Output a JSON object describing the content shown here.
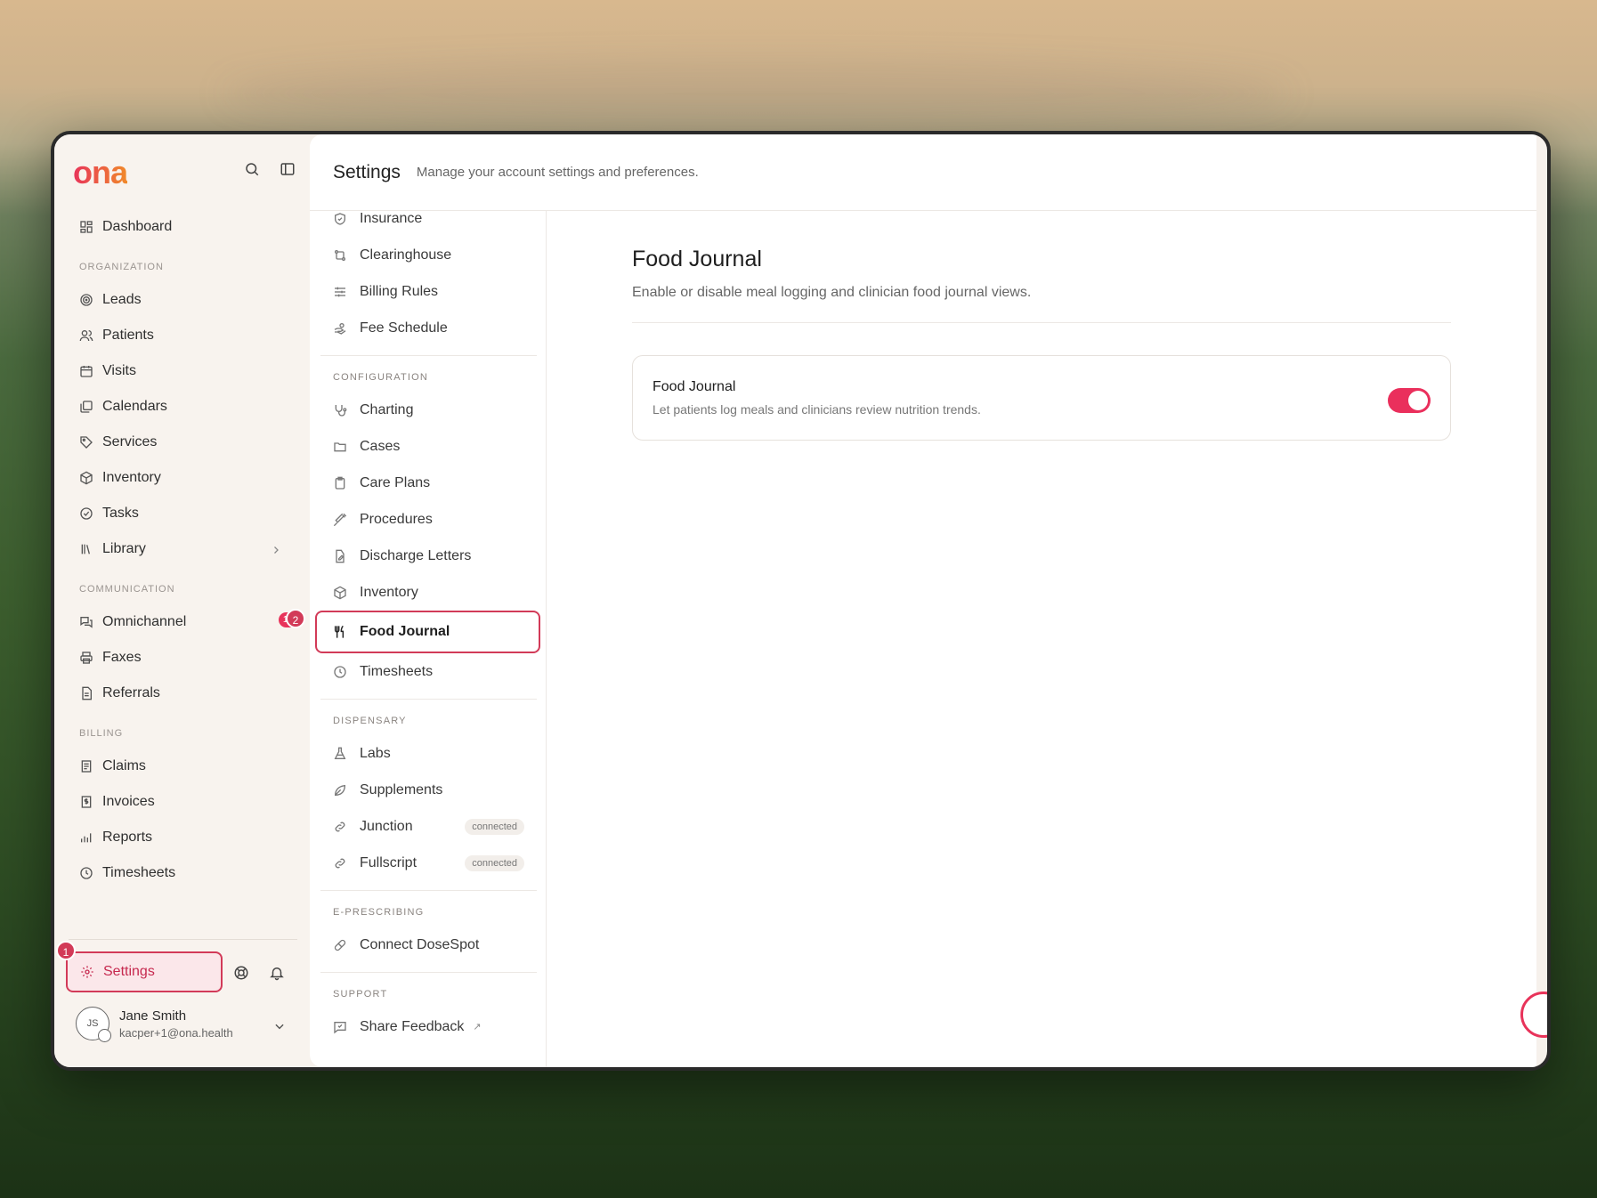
{
  "app": {
    "logo": "ona"
  },
  "sidebar": {
    "dashboard": "Dashboard",
    "sections": {
      "organization": "ORGANIZATION",
      "communication": "COMMUNICATION",
      "billing": "BILLING"
    },
    "organization_items": [
      "Leads",
      "Patients",
      "Visits",
      "Calendars",
      "Services",
      "Inventory",
      "Tasks",
      "Library"
    ],
    "communication_items": [
      "Omnichannel",
      "Faxes",
      "Referrals"
    ],
    "omnichannel_count": "13",
    "billing_items": [
      "Claims",
      "Invoices",
      "Reports",
      "Timesheets"
    ],
    "settings_label": "Settings",
    "settings_step": "1",
    "user": {
      "initials": "JS",
      "name": "Jane Smith",
      "email": "kacper+1@ona.health"
    }
  },
  "header": {
    "title": "Settings",
    "subtitle": "Manage your account settings and preferences."
  },
  "subnav": {
    "billing_items": [
      "Insurance",
      "Clearinghouse",
      "Billing Rules",
      "Fee Schedule"
    ],
    "configuration_label": "CONFIGURATION",
    "configuration_items": [
      "Charting",
      "Cases",
      "Care Plans",
      "Procedures",
      "Discharge Letters",
      "Inventory",
      "Food Journal",
      "Timesheets"
    ],
    "active_step": "2",
    "dispensary_label": "DISPENSARY",
    "dispensary_items": [
      "Labs",
      "Supplements",
      "Junction",
      "Fullscript"
    ],
    "connected_label": "connected",
    "eprescribing_label": "E-PRESCRIBING",
    "eprescribing_items": [
      "Connect DoseSpot"
    ],
    "support_label": "SUPPORT",
    "support_items": [
      "Share Feedback"
    ]
  },
  "content": {
    "title": "Food Journal",
    "description": "Enable or disable meal logging and clinician food journal views.",
    "card": {
      "title": "Food Journal",
      "description": "Let patients log meals and clinicians review nutrition trends.",
      "enabled": true
    }
  },
  "colors": {
    "accent": "#e8335a",
    "toggle_on": "#ea2f5c"
  }
}
